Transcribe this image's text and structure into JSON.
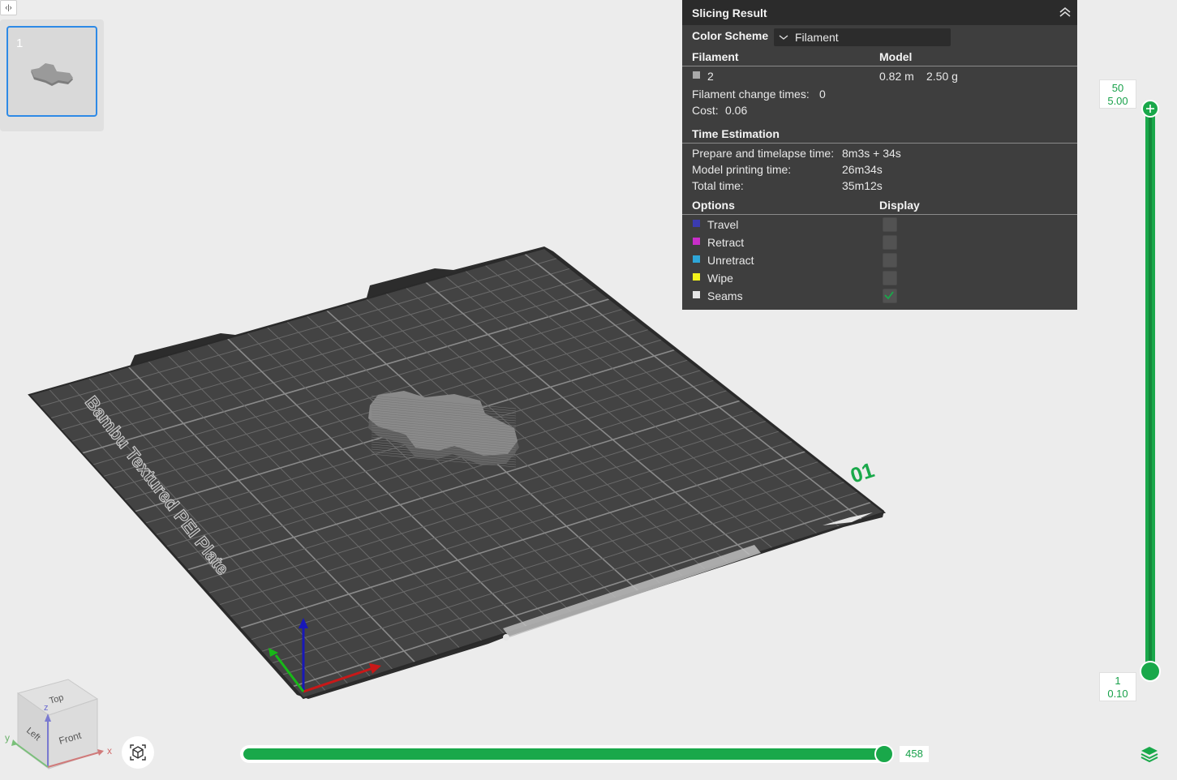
{
  "toolbar": {
    "toggle_glyph": "‹|›"
  },
  "plates": [
    {
      "index": "1"
    }
  ],
  "bed": {
    "plate_label": "Bambu Textured PEI Plate",
    "plate_number": "01"
  },
  "slicing_result": {
    "title": "Slicing Result",
    "color_scheme_label": "Color Scheme",
    "color_scheme_value": "Filament",
    "filament_header": "Filament",
    "model_header": "Model",
    "filament": {
      "id": "2",
      "color": "#a9a9a9",
      "length": "0.82 m",
      "weight": "2.50 g"
    },
    "filament_change_label": "Filament change times:",
    "filament_change_value": "0",
    "cost_label": "Cost:",
    "cost_value": "0.06",
    "time_header": "Time Estimation",
    "prepare_label": "Prepare and timelapse time:",
    "prepare_value": "8m3s + 34s",
    "model_time_label": "Model printing time:",
    "model_time_value": "26m34s",
    "total_label": "Total time:",
    "total_value": "35m12s",
    "options_header": "Options",
    "display_header": "Display",
    "options": [
      {
        "label": "Travel",
        "color": "#3b3bb0",
        "checked": false
      },
      {
        "label": "Retract",
        "color": "#c92ec9",
        "checked": false
      },
      {
        "label": "Unretract",
        "color": "#2ea6d8",
        "checked": false
      },
      {
        "label": "Wipe",
        "color": "#f2f21c",
        "checked": false
      },
      {
        "label": "Seams",
        "color": "#e6e6e6",
        "checked": true
      }
    ]
  },
  "layer_slider": {
    "top_layer": "50",
    "top_height": "5.00",
    "bottom_layer": "1",
    "bottom_height": "0.10"
  },
  "move_slider": {
    "value": "458"
  },
  "view_cube": {
    "top": "Top",
    "left": "Left",
    "front": "Front",
    "x": "x",
    "y": "y",
    "z": "z"
  },
  "colors": {
    "accent": "#19a84a",
    "selection": "#2e8ae6",
    "panel": "#3e3e3e"
  }
}
